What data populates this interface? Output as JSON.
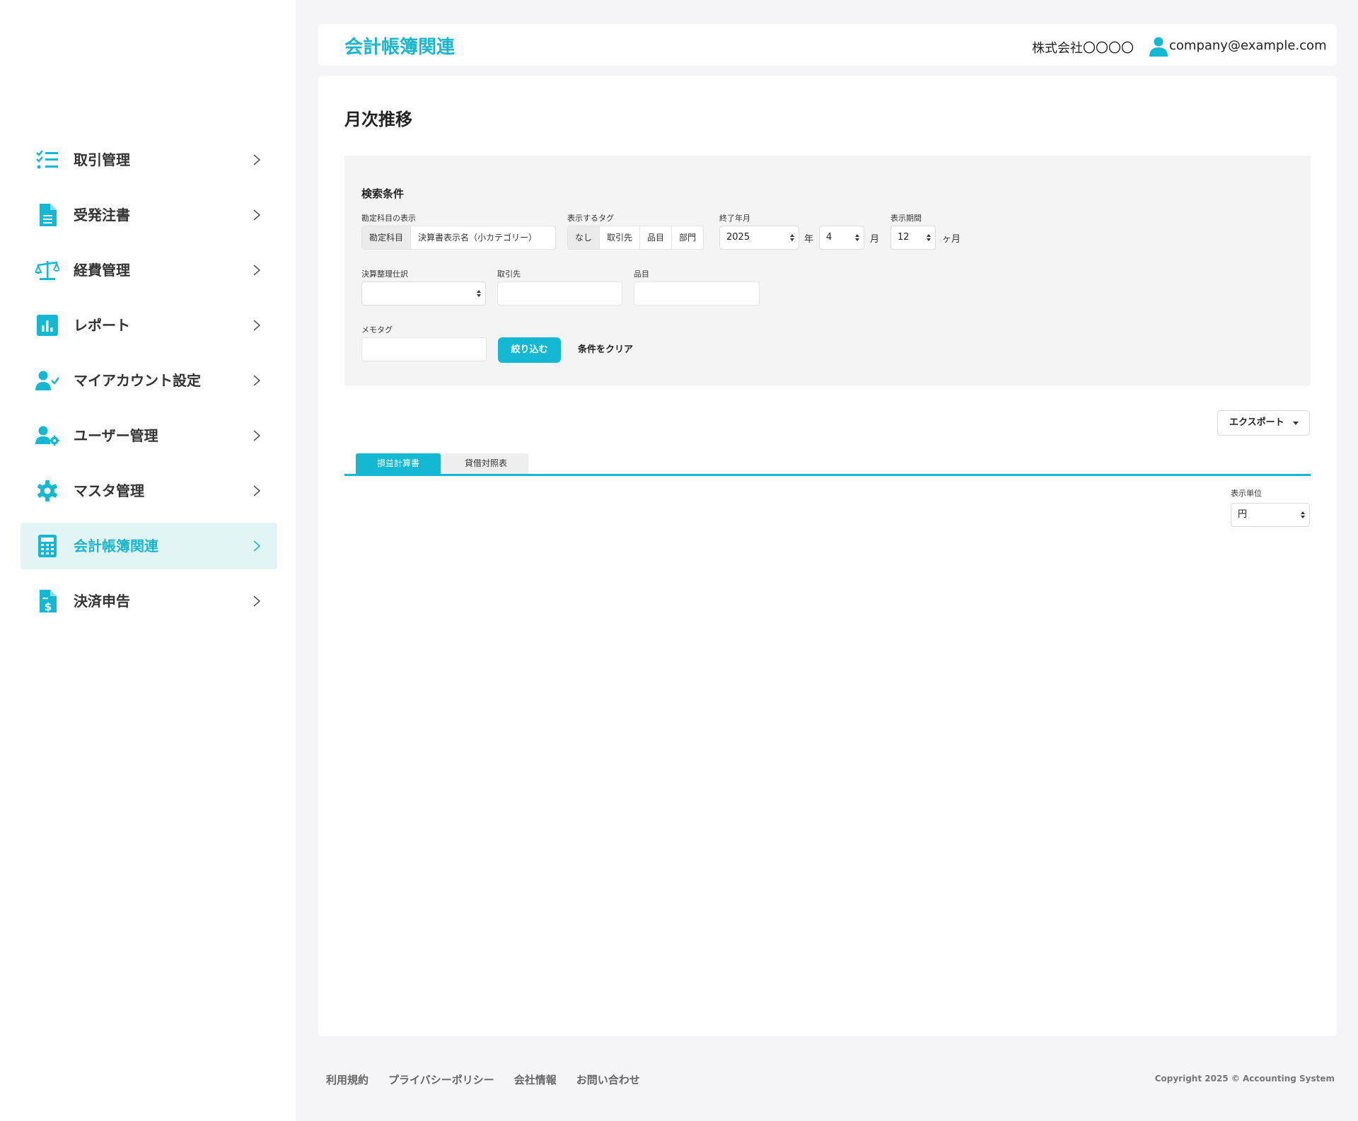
{
  "sidebar": {
    "items": [
      {
        "label": "取引管理",
        "icon": "checklist-icon"
      },
      {
        "label": "受発注書",
        "icon": "document-icon"
      },
      {
        "label": "経費管理",
        "icon": "scale-icon"
      },
      {
        "label": "レポート",
        "icon": "bar-chart-icon"
      },
      {
        "label": "マイアカウント設定",
        "icon": "user-check-icon"
      },
      {
        "label": "ユーザー管理",
        "icon": "user-gear-icon"
      },
      {
        "label": "マスタ管理",
        "icon": "gear-icon"
      },
      {
        "label": "会計帳簿関連",
        "icon": "calculator-icon",
        "active": true
      },
      {
        "label": "決済申告",
        "icon": "dollar-document-icon"
      }
    ]
  },
  "header": {
    "title": "会計帳簿関連",
    "company": "株式会社〇〇〇〇",
    "email": "company@example.com"
  },
  "main": {
    "page_title": "月次推移",
    "search": {
      "title": "検索条件",
      "account_display": {
        "label": "勘定科目の表示",
        "options": [
          "勘定科目",
          "決算書表示名（小カテゴリー）"
        ],
        "selected": "勘定科目"
      },
      "tags": {
        "label": "表示するタグ",
        "options": [
          "なし",
          "取引先",
          "品目",
          "部門"
        ],
        "selected": "なし"
      },
      "end_month": {
        "label": "終了年月",
        "year": "2025",
        "year_unit": "年",
        "month": "4",
        "month_unit": "月"
      },
      "period": {
        "label": "表示期間",
        "value": "12",
        "unit": "ヶ月"
      },
      "closing_entry": {
        "label": "決算整理仕訳",
        "value": ""
      },
      "partner": {
        "label": "取引先",
        "value": ""
      },
      "item": {
        "label": "品目",
        "value": ""
      },
      "memo_tag": {
        "label": "メモタグ",
        "value": ""
      },
      "filter_button": "絞り込む",
      "clear_button": "条件をクリア"
    },
    "export_button": "エクスポート",
    "tabs": [
      "損益計算書",
      "貸借対照表"
    ],
    "display_unit": {
      "label": "表示単位",
      "value": "円"
    }
  },
  "footer": {
    "links": [
      "利用規約",
      "プライバシーポリシー",
      "会社情報",
      "お問い合わせ"
    ],
    "copyright": "Copyright 2025 © Accounting System"
  },
  "colors": {
    "accent": "#14b8d2",
    "active_bg": "#e3f6f5",
    "panel_bg": "#f5f4f4",
    "page_bg": "#f5f5f7"
  }
}
